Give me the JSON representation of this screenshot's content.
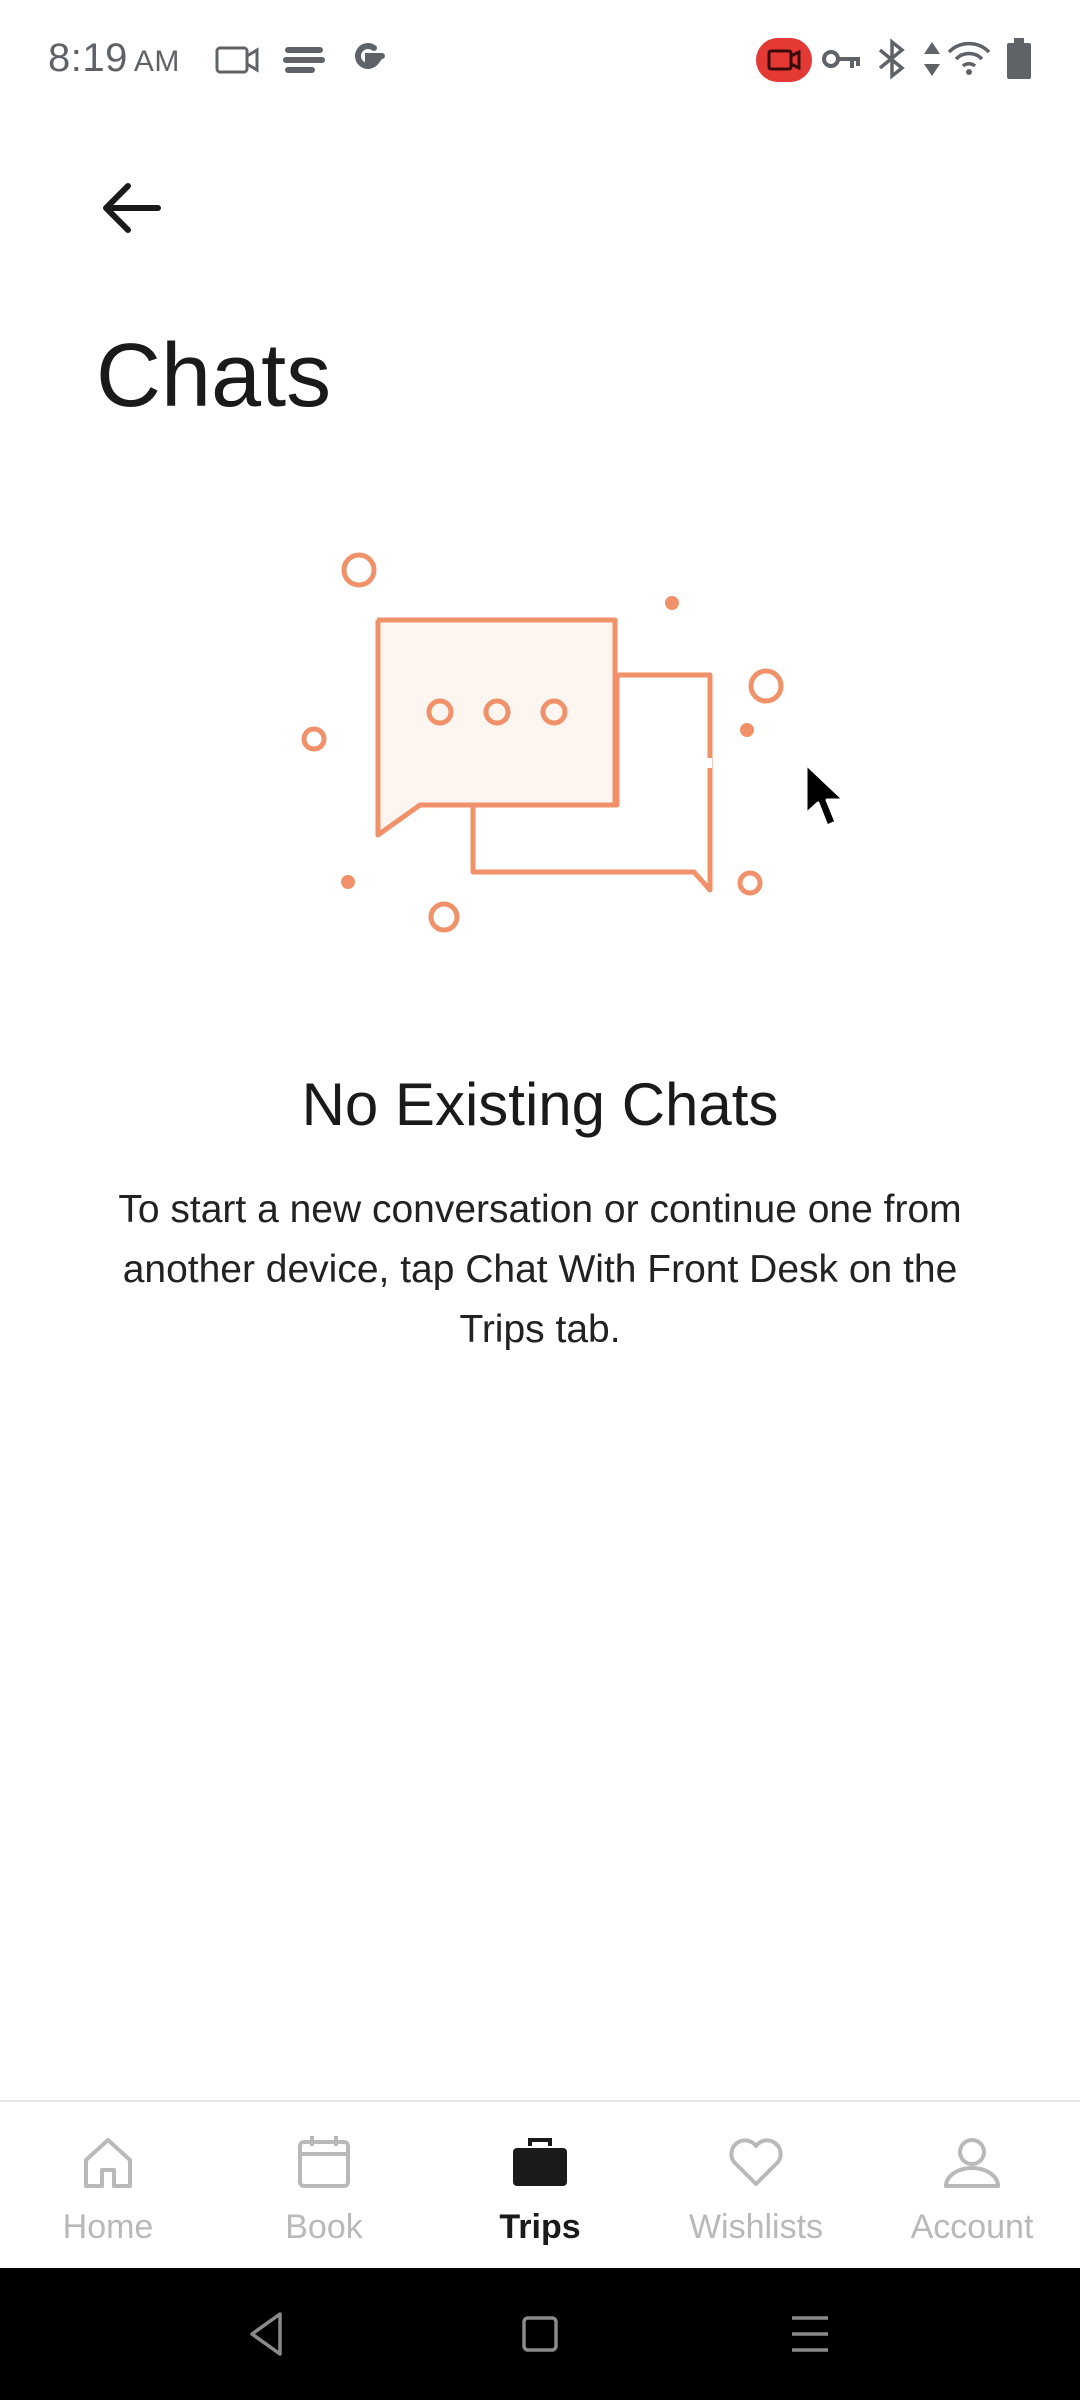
{
  "status_bar": {
    "time": "8:19",
    "ampm": "AM",
    "colors": {
      "text": "#5f6368",
      "record_badge": "#e53935"
    }
  },
  "header": {
    "back_icon": "arrow-left-icon",
    "title": "Chats"
  },
  "empty_state": {
    "illustration": "chat-bubbles-illustration",
    "title": "No Existing Chats",
    "description": "To start a new conversation or continue one from another device, tap Chat With Front Desk on the Trips tab."
  },
  "bottom_nav": {
    "items": [
      {
        "label": "Home",
        "icon": "home-icon",
        "active": false
      },
      {
        "label": "Book",
        "icon": "calendar-icon",
        "active": false
      },
      {
        "label": "Trips",
        "icon": "briefcase-icon",
        "active": true
      },
      {
        "label": "Wishlists",
        "icon": "heart-icon",
        "active": false
      },
      {
        "label": "Account",
        "icon": "person-icon",
        "active": false
      }
    ]
  },
  "colors": {
    "accent": "#f0916a",
    "inactive_nav": "#b9b9b9",
    "title_text": "#1a1a1a"
  }
}
